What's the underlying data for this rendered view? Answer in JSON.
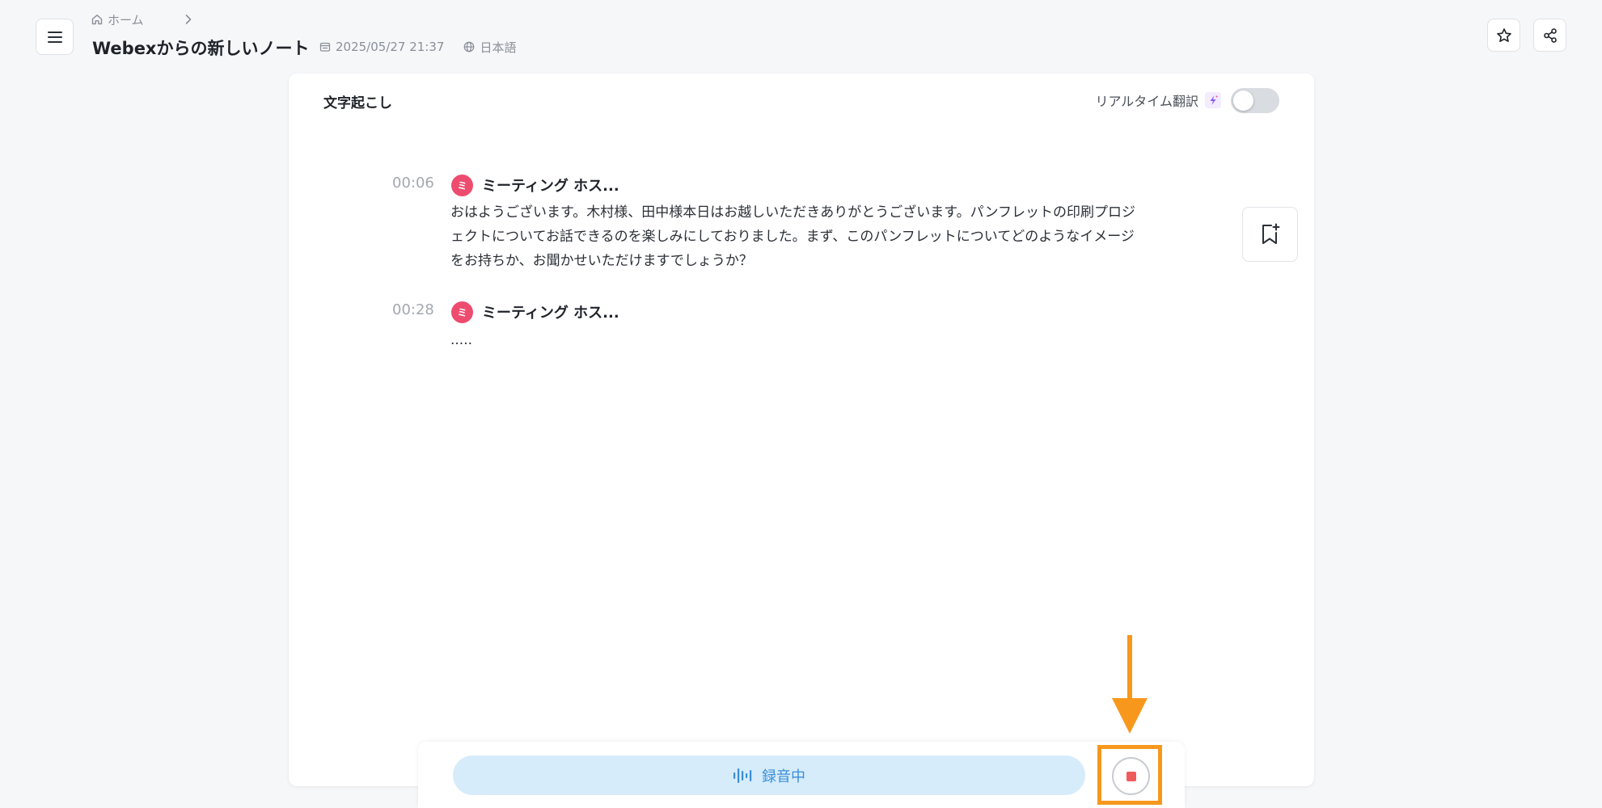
{
  "header": {
    "breadcrumb_home": "ホーム",
    "title": "Webexからの新しいノート",
    "datetime": "2025/05/27 21:37",
    "language": "日本語"
  },
  "transcript": {
    "title": "文字起こし",
    "realtime_translation_label": "リアルタイム翻訳",
    "realtime_translation_enabled": false,
    "entries": [
      {
        "time": "00:06",
        "avatar": "ミ",
        "speaker": "ミーティング ホス...",
        "text": "おはようございます。木村様、田中様本日はお越しいただきありがとうございます。パンフレットの印刷プロジェクトについてお話できるのを楽しみにしておりました。まず、このパンフレットについてどのようなイメージをお持ちか、お聞かせいただけますでしょうか？"
      },
      {
        "time": "00:28",
        "avatar": "ミ",
        "speaker": "ミーティング ホス...",
        "text": "....."
      }
    ]
  },
  "recording": {
    "status_label": "録音中"
  },
  "colors": {
    "accent_orange": "#f7981d",
    "avatar_pink": "#ee4c6f",
    "recording_blue": "#3a8ed8",
    "stop_red": "#ef5b5b"
  },
  "icons": [
    "menu-icon",
    "home-icon",
    "chevron-right-icon",
    "calendar-icon",
    "globe-icon",
    "star-icon",
    "share-icon",
    "sparkle-icon",
    "bookmark-add-icon",
    "waveform-icon",
    "stop-icon"
  ]
}
